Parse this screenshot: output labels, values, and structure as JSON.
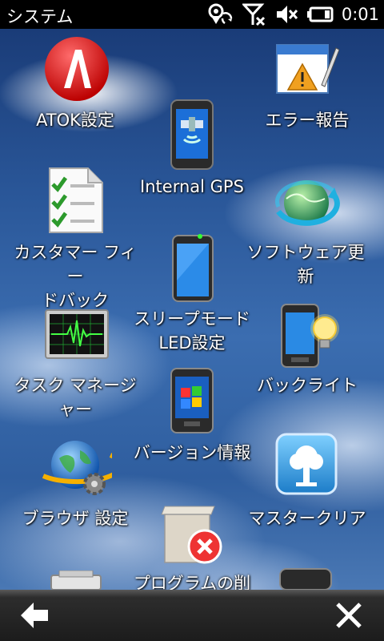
{
  "status_bar": {
    "title": "システム",
    "clock": "0:01",
    "icons": [
      "gps-sync-icon",
      "signal-off-icon",
      "speaker-muted-icon",
      "battery-icon"
    ]
  },
  "items": [
    {
      "label": "ATOK設定",
      "icon": "atok-icon"
    },
    {
      "label": "エラー報告",
      "icon": "error-report-icon"
    },
    {
      "label": "Internal GPS",
      "icon": "gps-phone-icon"
    },
    {
      "label": "カスタマー フィー\nドバック",
      "icon": "checklist-document-icon"
    },
    {
      "label": "ソフトウェア更新",
      "icon": "globe-refresh-icon"
    },
    {
      "label": "スリープモード\nLED設定",
      "icon": "phone-led-icon"
    },
    {
      "label": "タスク マネージ\nャー",
      "icon": "heartbeat-monitor-icon"
    },
    {
      "label": "バックライト",
      "icon": "phone-lightbulb-icon"
    },
    {
      "label": "バージョン情報",
      "icon": "windows-phone-icon"
    },
    {
      "label": "ブラウザ 設定",
      "icon": "globe-gear-icon"
    },
    {
      "label": "マスタークリア",
      "icon": "tree-reset-icon"
    },
    {
      "label": "プログラムの削",
      "icon": "remove-program-icon"
    }
  ],
  "bottom_bar": {
    "back": "back-arrow-icon",
    "close": "close-icon"
  }
}
